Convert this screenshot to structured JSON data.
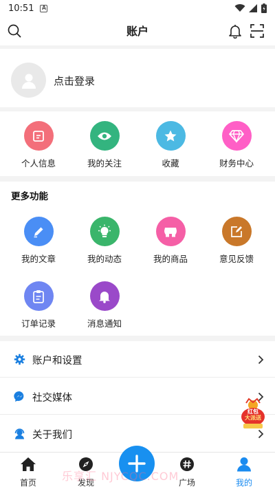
{
  "status_bar": {
    "time": "10:51",
    "notif_icon": "a-letter-icon"
  },
  "app_bar": {
    "title": "账户"
  },
  "login": {
    "label": "点击登录"
  },
  "quick_actions": [
    {
      "label": "个人信息",
      "color": "#f36f7a",
      "icon": "edit-icon"
    },
    {
      "label": "我的关注",
      "color": "#33b47f",
      "icon": "eye-icon"
    },
    {
      "label": "收藏",
      "color": "#4cb9e3",
      "icon": "star-icon"
    },
    {
      "label": "财务中心",
      "color": "#ff5fc6",
      "icon": "diamond-icon"
    }
  ],
  "more": {
    "title": "更多功能",
    "items": [
      {
        "label": "我的文章",
        "color": "#4a8ef5",
        "icon": "pencil-icon"
      },
      {
        "label": "我的动态",
        "color": "#3ab56b",
        "icon": "bulb-icon"
      },
      {
        "label": "我的商品",
        "color": "#f55fa6",
        "icon": "shop-icon"
      },
      {
        "label": "意见反馈",
        "color": "#c9782a",
        "icon": "feedback-icon"
      },
      {
        "label": "订单记录",
        "color": "#6f86f2",
        "icon": "clipboard-icon"
      },
      {
        "label": "消息通知",
        "color": "#9a49c9",
        "icon": "bell-icon"
      }
    ]
  },
  "menu": [
    {
      "label": "账户和设置",
      "icon": "gear-icon"
    },
    {
      "label": "社交媒体",
      "icon": "messenger-icon"
    },
    {
      "label": "关于我们",
      "icon": "support-icon"
    }
  ],
  "promo": {
    "line1": "红包",
    "line2": "大派送"
  },
  "bottom_nav": [
    {
      "label": "首页",
      "icon": "home-icon"
    },
    {
      "label": "发现",
      "icon": "compass-icon"
    },
    {
      "label": "广场",
      "icon": "hashtag-icon"
    },
    {
      "label": "我的",
      "icon": "person-icon",
      "active": true
    }
  ],
  "watermark": "乐享汇 NJYCQC.COM",
  "colors": {
    "accent": "#1890f0",
    "icon_blue": "#1a7fe0"
  }
}
